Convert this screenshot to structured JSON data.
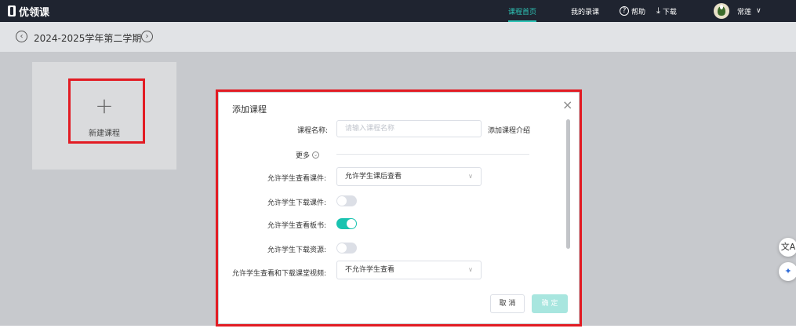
{
  "topbar": {
    "logo_text": "优领课",
    "nav": {
      "home": "课程首页",
      "my_recordings": "我的录课",
      "help": "帮助",
      "download": "下载"
    },
    "user_name": "常莲"
  },
  "term": {
    "title": "2024-2025学年第二学期"
  },
  "new_course_card": {
    "plus": "+",
    "label": "新建课程"
  },
  "dialog": {
    "title": "添加课程",
    "close": "×",
    "course_name_label": "课程名称:",
    "course_name_value": "",
    "course_name_placeholder": "请输入课程名称",
    "add_intro_link": "添加课程介绍",
    "more_label": "更多",
    "fields": {
      "view_courseware_label": "允许学生查看课件:",
      "view_courseware_value": "允许学生课后查看",
      "download_courseware_label": "允许学生下载课件:",
      "download_courseware_on": false,
      "view_board_label": "允许学生查看板书:",
      "view_board_on": true,
      "download_resources_label": "允许学生下载资源:",
      "download_resources_on": false,
      "classroom_video_label": "允许学生查看和下载课堂视频:",
      "classroom_video_value": "不允许学生查看"
    },
    "cancel_label": "取 消",
    "ok_label": "确 定"
  },
  "colors": {
    "topbar": "#1f2430",
    "accent": "#19c3b0",
    "highlight": "#e21b23"
  }
}
